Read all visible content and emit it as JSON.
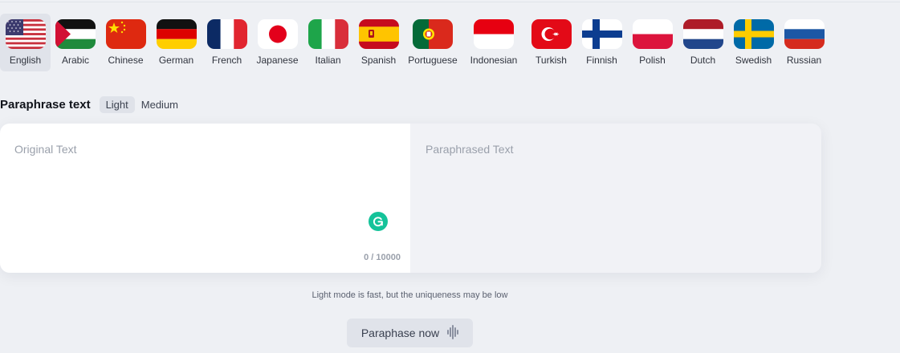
{
  "languages": [
    {
      "label": "English",
      "flag": "us-flag-icon",
      "selected": true
    },
    {
      "label": "Arabic",
      "flag": "arabic-flag-icon",
      "selected": false
    },
    {
      "label": "Chinese",
      "flag": "china-flag-icon",
      "selected": false
    },
    {
      "label": "German",
      "flag": "germany-flag-icon",
      "selected": false
    },
    {
      "label": "French",
      "flag": "france-flag-icon",
      "selected": false
    },
    {
      "label": "Japanese",
      "flag": "japan-flag-icon",
      "selected": false
    },
    {
      "label": "Italian",
      "flag": "italy-flag-icon",
      "selected": false
    },
    {
      "label": "Spanish",
      "flag": "spain-flag-icon",
      "selected": false
    },
    {
      "label": "Portuguese",
      "flag": "portugal-flag-icon",
      "selected": false
    },
    {
      "label": "Indonesian",
      "flag": "indonesia-flag-icon",
      "selected": false
    },
    {
      "label": "Turkish",
      "flag": "turkey-flag-icon",
      "selected": false
    },
    {
      "label": "Finnish",
      "flag": "finland-flag-icon",
      "selected": false
    },
    {
      "label": "Polish",
      "flag": "poland-flag-icon",
      "selected": false
    },
    {
      "label": "Dutch",
      "flag": "netherlands-flag-icon",
      "selected": false
    },
    {
      "label": "Swedish",
      "flag": "sweden-flag-icon",
      "selected": false
    },
    {
      "label": "Russian",
      "flag": "russia-flag-icon",
      "selected": false
    }
  ],
  "mode": {
    "title": "Paraphrase text",
    "options": [
      "Light",
      "Medium"
    ],
    "selected": "Light"
  },
  "editor": {
    "input_placeholder": "Original Text",
    "output_placeholder": "Paraphrased Text",
    "counter": "0 / 10000"
  },
  "hint": "Light mode is fast, but the uniqueness may be low",
  "submit_label": "Paraphase now",
  "colors": {
    "background": "#eef0f4",
    "selected_chip": "#e0e3ea",
    "grammarly": "#15c39a",
    "output_pane": "#f1f2f6"
  }
}
